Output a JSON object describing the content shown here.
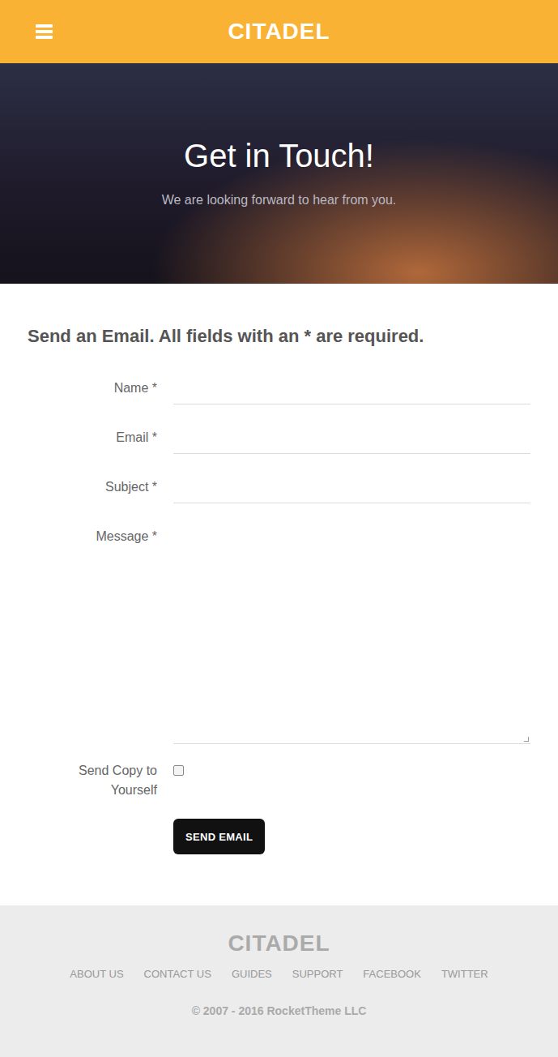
{
  "header": {
    "logo": "CITADEL"
  },
  "hero": {
    "title": "Get in Touch!",
    "subtitle": "We are looking forward to hear from you."
  },
  "form": {
    "heading": "Send an Email. All fields with an * are required.",
    "fields": [
      {
        "label": "Name *",
        "kind": "text"
      },
      {
        "label": "Email *",
        "kind": "text"
      },
      {
        "label": "Subject *",
        "kind": "text"
      },
      {
        "label": "Message *",
        "kind": "textarea"
      }
    ],
    "copy": {
      "label": "Send Copy to Yourself",
      "checked": false
    },
    "button": "SEND EMAIL"
  },
  "footer": {
    "logo": "CITADEL",
    "links": [
      "ABOUT US",
      "CONTACT US",
      "GUIDES",
      "SUPPORT",
      "FACEBOOK",
      "TWITTER"
    ],
    "copyright": "© 2007 - 2016 RocketTheme LLC"
  }
}
